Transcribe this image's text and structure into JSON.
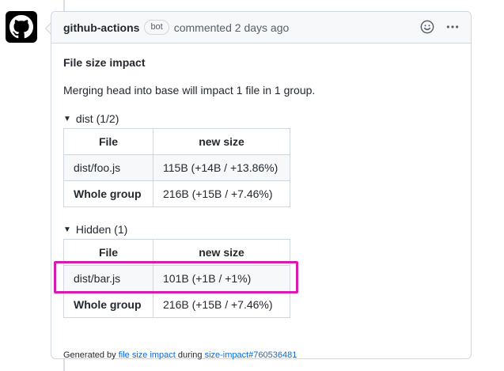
{
  "comment": {
    "author": "github-actions",
    "badge": "bot",
    "meta": "commented 2 days ago",
    "title": "File size impact",
    "summary": "Merging head into base will impact 1 file in 1 group."
  },
  "groups": [
    {
      "label": "dist (1/2)",
      "headers": [
        "File",
        "new size"
      ],
      "rows": [
        [
          "dist/foo.js",
          "115B (+14B / +13.86%)"
        ],
        [
          "Whole group",
          "216B (+15B / +7.46%)"
        ]
      ]
    },
    {
      "label": "Hidden (1)",
      "headers": [
        "File",
        "new size"
      ],
      "rows": [
        [
          "dist/bar.js",
          "101B (+1B / +1%)"
        ],
        [
          "Whole group",
          "216B (+15B / +7.46%)"
        ]
      ]
    }
  ],
  "footer": {
    "prefix": "Generated by",
    "link1": "file size impact",
    "middle": "during",
    "link2": "size-impact#760536481"
  },
  "colors": {
    "highlight": "#d81bb0",
    "link": "#0969da"
  },
  "icons": {
    "avatar": "github-mark-icon",
    "emoji": "smiley-icon",
    "more": "kebab-horizontal-icon"
  }
}
